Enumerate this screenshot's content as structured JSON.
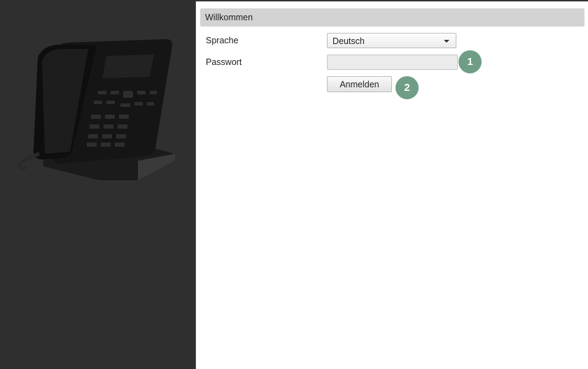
{
  "sidebar": {
    "image": "desk-phone-image"
  },
  "header": {
    "title": "Willkommen"
  },
  "form": {
    "language_label": "Sprache",
    "language_value": "Deutsch",
    "password_label": "Passwort",
    "password_value": "",
    "login_label": "Anmelden"
  },
  "annotations": {
    "badge_1": "1",
    "badge_2": "2"
  },
  "colors": {
    "sidebar": "#2f2f2f",
    "header": "#d3d3d3",
    "badge": "#6f9d86"
  }
}
